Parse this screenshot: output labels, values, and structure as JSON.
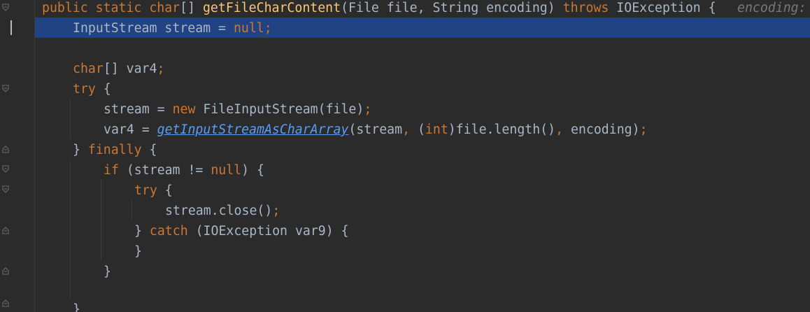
{
  "code": {
    "line1": {
      "kw1": "public static ",
      "kw2": "char",
      "t1": "[] ",
      "fn": "getFileCharContent",
      "t2": "(File file, String encoding) ",
      "kw3": "throws",
      "t3": " IOException {",
      "hint": "encoding:"
    },
    "line2": {
      "t1": "InputStream stream = ",
      "kw1": "null",
      "t2": ";"
    },
    "line4": {
      "kw1": "char",
      "t1": "[] var4",
      "t2": ";"
    },
    "line5": {
      "kw1": "try",
      "t1": " {"
    },
    "line6": {
      "t1": "stream = ",
      "kw1": "new",
      "t2": " FileInputStream(file)",
      "t3": ";"
    },
    "line7": {
      "t1": "var4 = ",
      "call": "getInputStreamAsCharArray",
      "t2": "(stream",
      "c1": ",",
      "t3": " (",
      "kw1": "int",
      "t4": ")file.length()",
      "c2": ",",
      "t5": " encoding)",
      "t6": ";"
    },
    "line8": {
      "t1": "} ",
      "kw1": "finally",
      "t2": " {"
    },
    "line9": {
      "kw1": "if",
      "t1": " (stream != ",
      "kw2": "null",
      "t2": ") {"
    },
    "line10": {
      "kw1": "try",
      "t1": " {"
    },
    "line11": {
      "t1": "stream.close()",
      "t2": ";"
    },
    "line12": {
      "t1": "} ",
      "kw1": "catch",
      "t2": " (IOException var9) {"
    },
    "line13": {
      "t1": "}"
    },
    "line14": {
      "t1": "}"
    },
    "line16": {
      "t1": "}"
    }
  },
  "colors": {
    "background": "#2b2b2b",
    "keyword": "#cc7832",
    "method_decl": "#ffc66d",
    "plain_text": "#a9b7c6",
    "static_call": "#589df6",
    "caret_line": "#214283",
    "inlay_hint": "#787878"
  },
  "icons": [
    "fold-open-icon",
    "fold-close-icon"
  ]
}
